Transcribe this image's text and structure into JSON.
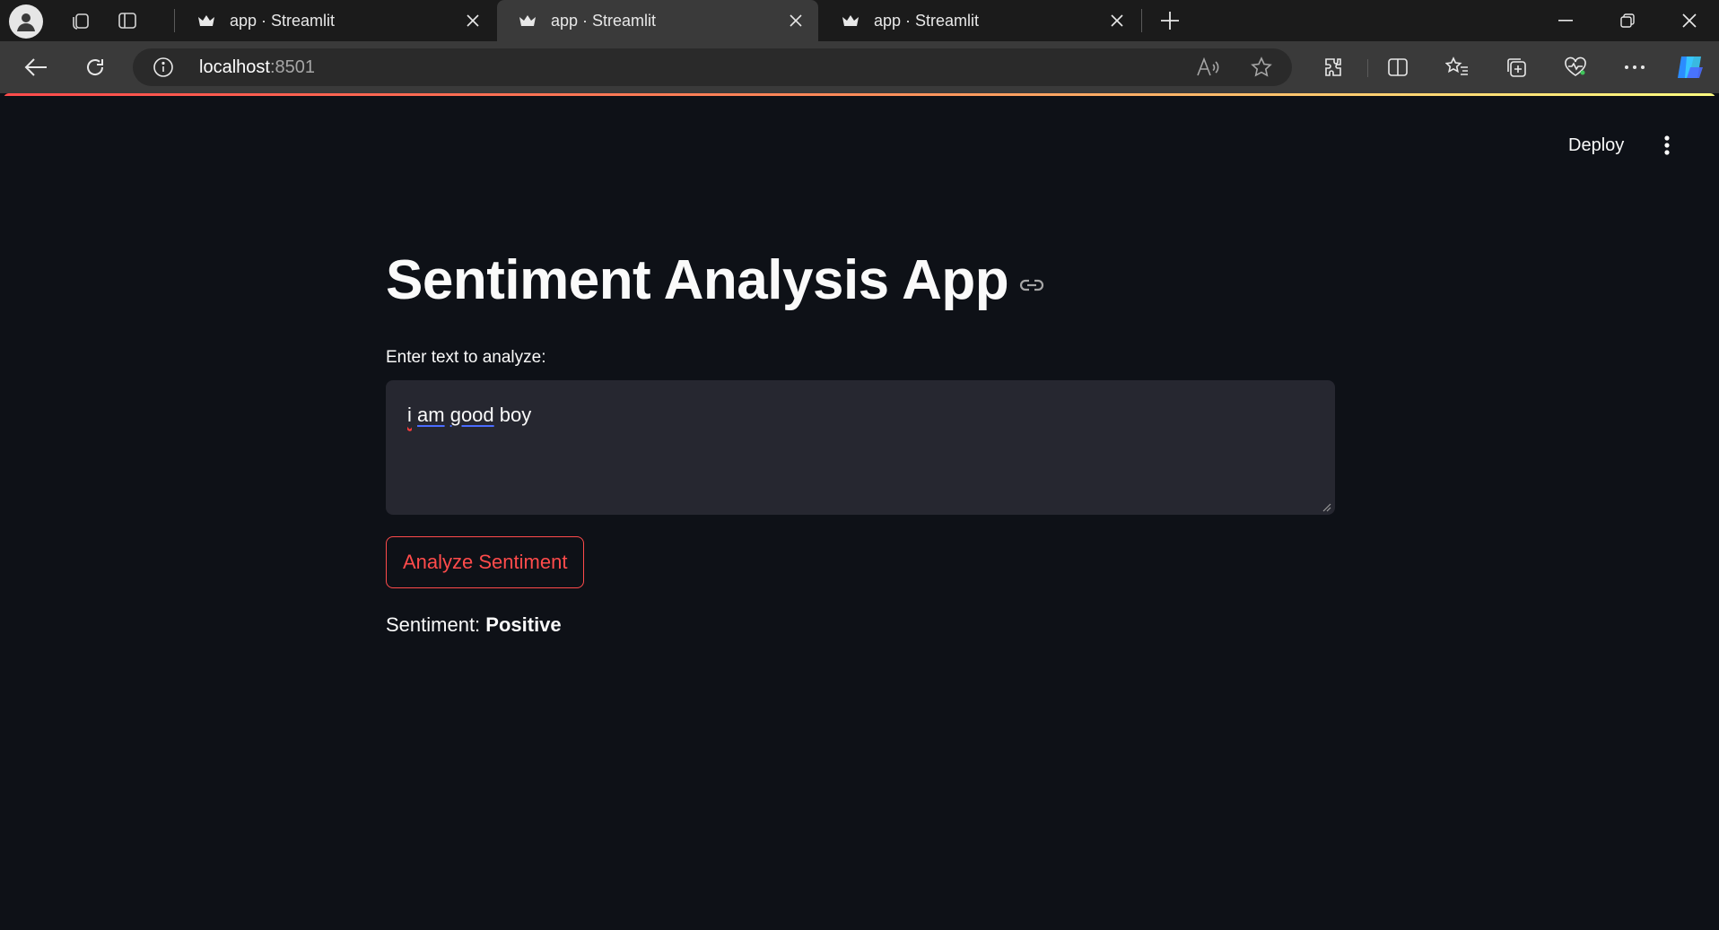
{
  "browser": {
    "tabs": [
      {
        "title": "app · Streamlit",
        "active": false
      },
      {
        "title": "app · Streamlit",
        "active": true
      },
      {
        "title": "app · Streamlit",
        "active": false
      }
    ],
    "url_host": "localhost",
    "url_port": ":8501"
  },
  "header": {
    "deploy_label": "Deploy"
  },
  "main": {
    "title": "Sentiment Analysis App",
    "input_label": "Enter text to analyze:",
    "input_words": [
      "i",
      "am",
      "good",
      "boy"
    ],
    "button_label": "Analyze Sentiment",
    "result_prefix": "Sentiment: ",
    "result_value": "Positive"
  },
  "colors": {
    "background": "#0e1117",
    "accent": "#ff4b4b",
    "input_bg": "#262730"
  }
}
